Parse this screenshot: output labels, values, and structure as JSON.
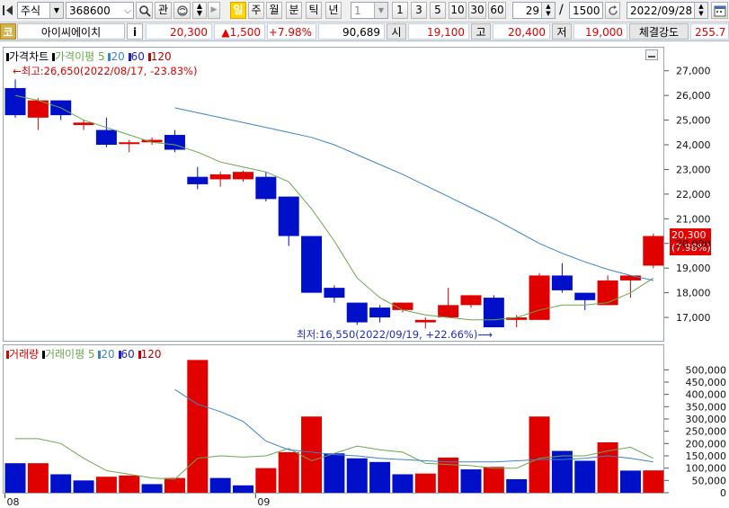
{
  "toolbar": {
    "market": "주식",
    "code": "368600",
    "btn_gwan": "관",
    "periods": [
      "일",
      "주",
      "월",
      "분",
      "틱",
      "년"
    ],
    "active_period": "일",
    "interval_value": "1",
    "intervals": [
      "1",
      "3",
      "5",
      "10",
      "30",
      "60"
    ],
    "count": "29",
    "separator": "/",
    "total": "1500",
    "date": "2022/09/28"
  },
  "infobar": {
    "market_tag": "코",
    "name": "아이씨에이치",
    "info_btn": "i",
    "price": "20,300",
    "change": "▲1,500",
    "change_pct": "+7.98%",
    "volume": "90,689",
    "open_label": "시",
    "open": "19,100",
    "high_label": "고",
    "high": "20,400",
    "low_label": "저",
    "low": "19,000",
    "strength_label": "체결강도",
    "strength": "255.7"
  },
  "price_panel": {
    "legend": {
      "title": "가격차트",
      "ma_label": "가격이평",
      "periods": [
        "5",
        "20",
        "60",
        "120"
      ],
      "colors": {
        "price": "#d00000",
        "ma5": "#6aa84f",
        "ma20": "#3d85c6",
        "ma60": "#1f1fbf",
        "ma120": "#c00000"
      }
    },
    "high_annotation": "←최고:26,650(2022/08/17, -23.83%)",
    "low_annotation": "최저:16,550(2022/09/19, +22.66%)⟶",
    "current_price_tag": "20,300",
    "current_pct_tag": "(7.98%)"
  },
  "volume_panel": {
    "legend": {
      "title": "거래량",
      "ma_label": "거래이평",
      "periods": [
        "5",
        "20",
        "60",
        "120"
      ]
    }
  },
  "x_labels": [
    {
      "index": 0,
      "text": "08"
    },
    {
      "index": 11,
      "text": "09"
    }
  ],
  "chart_data": [
    {
      "type": "candlestick",
      "title": "가격차트",
      "ylim": [
        16200,
        27500
      ],
      "yticks": [
        17000,
        18000,
        19000,
        20000,
        21000,
        22000,
        23000,
        24000,
        25000,
        26000,
        27000
      ],
      "ytick_labels": [
        "17,000",
        "18,000",
        "19,000",
        "20,000",
        "21,000",
        "22,000",
        "23,000",
        "24,000",
        "25,000",
        "26,000",
        "27,000"
      ],
      "candles": [
        {
          "o": 26300,
          "h": 26650,
          "l": 25100,
          "c": 25200
        },
        {
          "o": 25100,
          "h": 25900,
          "l": 24600,
          "c": 25800
        },
        {
          "o": 25800,
          "h": 25800,
          "l": 25000,
          "c": 25200
        },
        {
          "o": 24800,
          "h": 25000,
          "l": 24600,
          "c": 24900
        },
        {
          "o": 24600,
          "h": 25100,
          "l": 23900,
          "c": 24000
        },
        {
          "o": 24100,
          "h": 24200,
          "l": 23700,
          "c": 24100
        },
        {
          "o": 24100,
          "h": 24300,
          "l": 24000,
          "c": 24200
        },
        {
          "o": 24400,
          "h": 24600,
          "l": 23700,
          "c": 23800
        },
        {
          "o": 22700,
          "h": 23100,
          "l": 22200,
          "c": 22400
        },
        {
          "o": 22600,
          "h": 22900,
          "l": 22300,
          "c": 22800
        },
        {
          "o": 22600,
          "h": 22950,
          "l": 22500,
          "c": 22900
        },
        {
          "o": 22700,
          "h": 22900,
          "l": 21700,
          "c": 21800
        },
        {
          "o": 21900,
          "h": 21900,
          "l": 19900,
          "c": 20300
        },
        {
          "o": 20300,
          "h": 20300,
          "l": 18000,
          "c": 18000
        },
        {
          "o": 18200,
          "h": 18300,
          "l": 17600,
          "c": 17800
        },
        {
          "o": 17600,
          "h": 17600,
          "l": 16700,
          "c": 16800
        },
        {
          "o": 17400,
          "h": 17500,
          "l": 16800,
          "c": 17000
        },
        {
          "o": 17300,
          "h": 17600,
          "l": 17200,
          "c": 17600
        },
        {
          "o": 16800,
          "h": 17000,
          "l": 16550,
          "c": 16900
        },
        {
          "o": 17000,
          "h": 18200,
          "l": 17000,
          "c": 17500
        },
        {
          "o": 17500,
          "h": 17900,
          "l": 17400,
          "c": 17900
        },
        {
          "o": 17800,
          "h": 17900,
          "l": 16600,
          "c": 16600
        },
        {
          "o": 16900,
          "h": 17100,
          "l": 16600,
          "c": 17000
        },
        {
          "o": 16900,
          "h": 18800,
          "l": 16900,
          "c": 18700
        },
        {
          "o": 18700,
          "h": 19200,
          "l": 18000,
          "c": 18100
        },
        {
          "o": 18000,
          "h": 18000,
          "l": 17300,
          "c": 17700
        },
        {
          "o": 17500,
          "h": 18700,
          "l": 17500,
          "c": 18500
        },
        {
          "o": 18500,
          "h": 18700,
          "l": 17800,
          "c": 18700
        },
        {
          "o": 19100,
          "h": 20400,
          "l": 19000,
          "c": 20300
        }
      ],
      "series": [
        {
          "name": "5",
          "color": "#6aa84f",
          "start": 0,
          "values": [
            26000,
            25800,
            25500,
            25000,
            24700,
            24400,
            24100,
            24000,
            23700,
            23300,
            23100,
            22900,
            22500,
            21400,
            20100,
            18600,
            17800,
            17300,
            17100,
            17000,
            16900,
            16900,
            17000,
            17300,
            17500,
            17500,
            17600,
            18000,
            18600
          ]
        },
        {
          "name": "20",
          "color": "#3d85c6",
          "start": 7,
          "values": [
            25500,
            25300,
            25100,
            24900,
            24700,
            24500,
            24300,
            24000,
            23600,
            23200,
            22800,
            22350,
            21900,
            21450,
            21000,
            20500,
            20000,
            19600,
            19250,
            18950,
            18700,
            18500
          ]
        }
      ]
    },
    {
      "type": "bar",
      "title": "거래량",
      "ylim": [
        0,
        545000
      ],
      "yticks": [
        0,
        50000,
        100000,
        150000,
        200000,
        250000,
        300000,
        350000,
        400000,
        450000,
        500000
      ],
      "ytick_labels": [
        "0",
        "50,000",
        "100,000",
        "150,000",
        "200,000",
        "250,000",
        "300,000",
        "350,000",
        "400,000",
        "450,000",
        "500,000"
      ],
      "values": [
        120000,
        120000,
        75000,
        50000,
        65000,
        70000,
        35000,
        60000,
        540000,
        60000,
        30000,
        100000,
        165000,
        310000,
        160000,
        140000,
        125000,
        75000,
        78000,
        143000,
        95000,
        105000,
        55000,
        310000,
        170000,
        130000,
        205000,
        90000,
        90689
      ],
      "up": [
        false,
        true,
        false,
        false,
        true,
        true,
        false,
        true,
        true,
        false,
        false,
        true,
        true,
        true,
        false,
        false,
        false,
        false,
        true,
        true,
        false,
        true,
        false,
        true,
        false,
        false,
        true,
        false,
        true
      ],
      "series": [
        {
          "name": "5",
          "color": "#6aa84f",
          "start": 0,
          "values": [
            220000,
            220000,
            200000,
            140000,
            90000,
            75000,
            60000,
            55000,
            140000,
            150000,
            145000,
            150000,
            180000,
            130000,
            160000,
            190000,
            175000,
            165000,
            120000,
            115000,
            110000,
            100000,
            100000,
            140000,
            150000,
            150000,
            170000,
            185000,
            140000
          ]
        },
        {
          "name": "20",
          "color": "#3d85c6",
          "start": 7,
          "values": [
            420000,
            360000,
            330000,
            290000,
            210000,
            175000,
            165000,
            155000,
            150000,
            140000,
            135000,
            130000,
            125000,
            125000,
            125000,
            130000,
            135000,
            135000,
            140000,
            150000,
            140000,
            125000
          ]
        }
      ]
    }
  ]
}
